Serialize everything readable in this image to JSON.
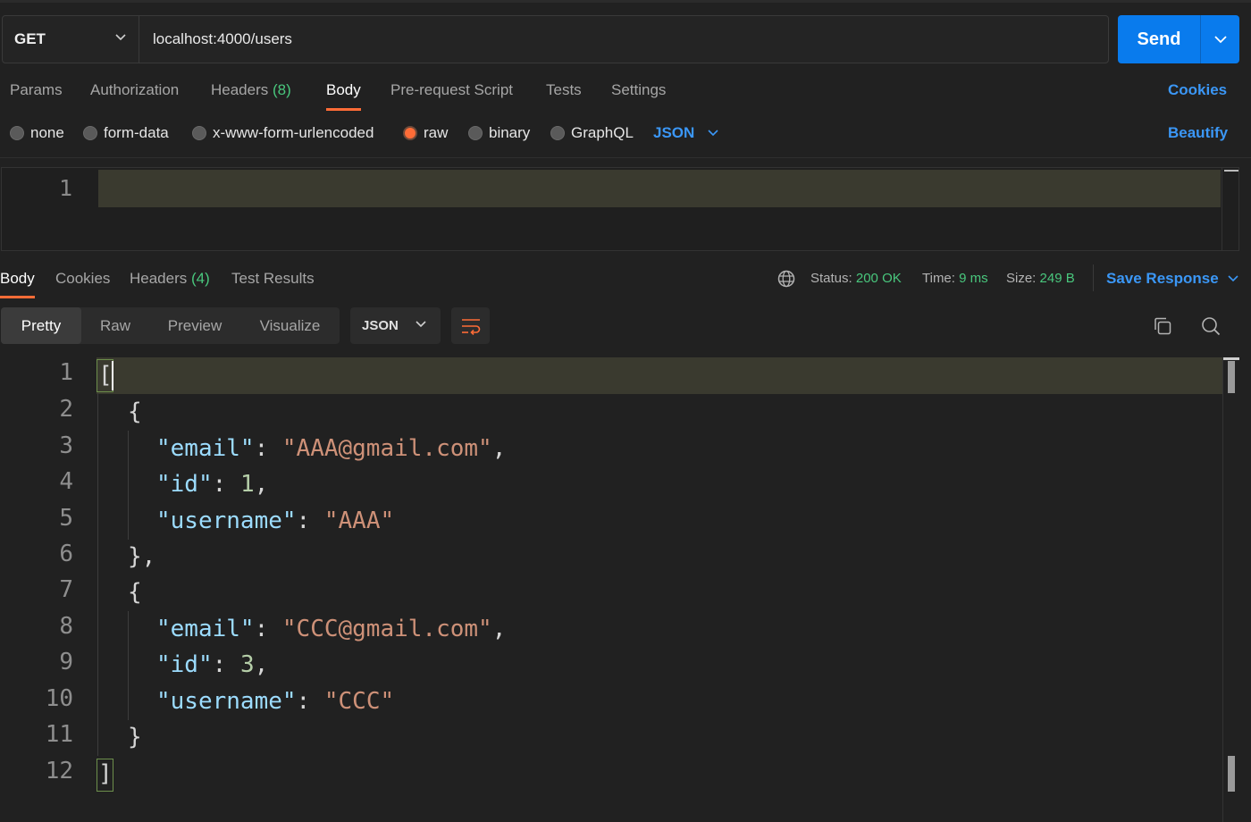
{
  "request": {
    "method": "GET",
    "url": "localhost:4000/users",
    "send_label": "Send"
  },
  "request_tabs": {
    "params": "Params",
    "authorization": "Authorization",
    "headers": "Headers",
    "headers_count": "(8)",
    "body": "Body",
    "pre_request": "Pre-request Script",
    "tests": "Tests",
    "settings": "Settings",
    "cookies": "Cookies"
  },
  "body_types": {
    "none": "none",
    "form_data": "form-data",
    "urlencoded": "x-www-form-urlencoded",
    "raw": "raw",
    "binary": "binary",
    "graphql": "GraphQL",
    "language": "JSON",
    "beautify": "Beautify",
    "selected": "raw"
  },
  "request_editor": {
    "line_numbers": [
      "1"
    ]
  },
  "response_tabs": {
    "body": "Body",
    "cookies": "Cookies",
    "headers": "Headers",
    "headers_count": "(4)",
    "test_results": "Test Results"
  },
  "response_meta": {
    "status_label": "Status:",
    "status_value": "200 OK",
    "time_label": "Time:",
    "time_value": "9 ms",
    "size_label": "Size:",
    "size_value": "249 B",
    "save_response": "Save Response"
  },
  "view_modes": {
    "pretty": "Pretty",
    "raw": "Raw",
    "preview": "Preview",
    "visualize": "Visualize",
    "format": "JSON",
    "active": "Pretty"
  },
  "response_code": {
    "line_numbers": [
      "1",
      "2",
      "3",
      "4",
      "5",
      "6",
      "7",
      "8",
      "9",
      "10",
      "11",
      "12"
    ],
    "l1": "[",
    "l2": "{",
    "k3": "\"email\"",
    "s3": "\"AAA@gmail.com\"",
    "k4": "\"id\"",
    "n4": "1",
    "k5": "\"username\"",
    "s5": "\"AAA\"",
    "l6": "},",
    "l7": "{",
    "k8": "\"email\"",
    "s8": "\"CCC@gmail.com\"",
    "k9": "\"id\"",
    "n9": "3",
    "k10": "\"username\"",
    "s10": "\"CCC\"",
    "l11": "}",
    "l12": "]",
    "colon": ": ",
    "comma": ","
  },
  "icons": {
    "method_dropdown": "chevron-down-icon",
    "send_dropdown": "chevron-down-icon",
    "language_dropdown": "chevron-down-icon",
    "network": "globe-icon",
    "save_dropdown": "chevron-down-icon",
    "wrap": "wrap-lines-icon",
    "copy": "copy-icon",
    "search": "search-icon"
  },
  "colors": {
    "accent": "#ff6c37",
    "send": "#097bed",
    "link": "#3b97f6",
    "status_green": "#49c77d",
    "json_key": "#9cdcfe",
    "json_string": "#ce9178",
    "json_number": "#b5cea8"
  }
}
